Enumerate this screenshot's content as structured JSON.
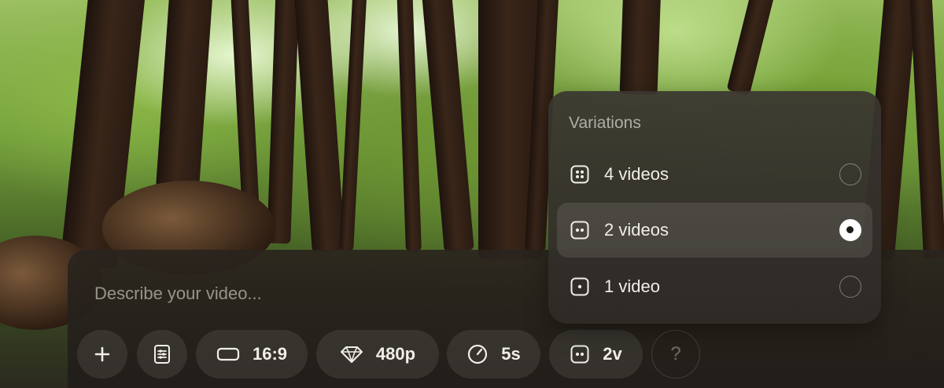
{
  "prompt": {
    "placeholder": "Describe your video..."
  },
  "toolbar": {
    "add_icon": "plus-icon",
    "prompt_settings_icon": "document-sliders-icon",
    "aspect_ratio": {
      "icon": "rectangle-icon",
      "label": "16:9"
    },
    "resolution": {
      "icon": "diamond-icon",
      "label": "480p"
    },
    "duration": {
      "icon": "clock-gauge-icon",
      "label": "5s"
    },
    "variations": {
      "icon": "two-dots-square-icon",
      "label": "2v"
    },
    "help": {
      "label": "?"
    }
  },
  "variations_menu": {
    "title": "Variations",
    "options": [
      {
        "label": "4 videos",
        "icon": "four-dots-square-icon",
        "selected": false
      },
      {
        "label": "2 videos",
        "icon": "two-dots-square-icon",
        "selected": true
      },
      {
        "label": "1 video",
        "icon": "one-dot-square-icon",
        "selected": false
      }
    ]
  },
  "colors": {
    "panel_bg": "#221e1a",
    "menu_bg": "#36322d",
    "text_primary": "#f1eee9",
    "text_muted": "#a9a49c",
    "radio_selected": "#ffffff"
  }
}
